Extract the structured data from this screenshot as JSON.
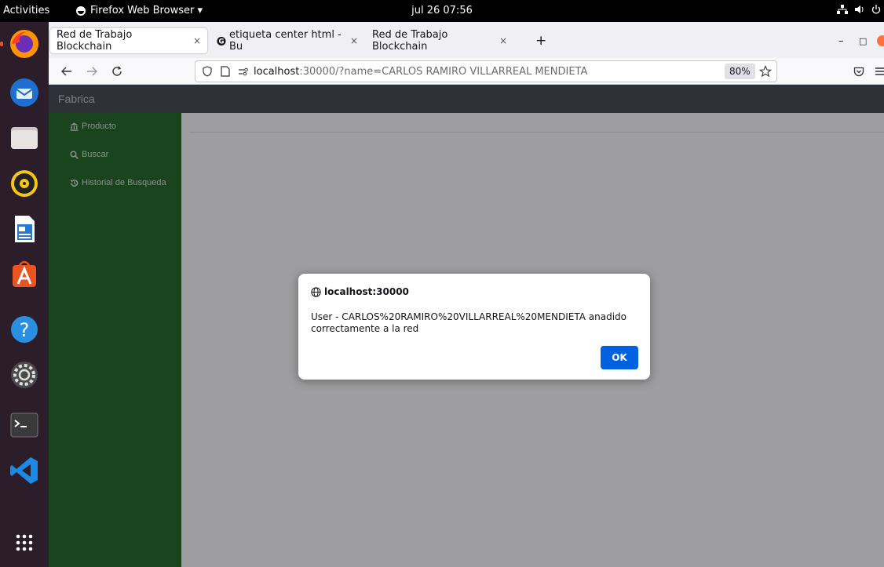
{
  "topbar": {
    "activities": "Activities",
    "app_menu": "Firefox Web Browser ▾",
    "clock": "jul 26  07:56"
  },
  "dock": {
    "items": [
      "firefox-icon",
      "thunderbird-icon",
      "files-icon",
      "rhythmbox-icon",
      "libreoffice-writer-icon",
      "software-center-icon",
      "help-icon",
      "settings-icon",
      "terminal-icon",
      "vscode-icon",
      "show-apps-icon"
    ]
  },
  "browser": {
    "tabs": [
      {
        "label": "Red de Trabajo Blockchain",
        "close": "×"
      },
      {
        "label": "etiqueta center html - Bu",
        "close": "×"
      },
      {
        "label": "Red de Trabajo Blockchain",
        "close": "×"
      }
    ],
    "new_tab": "+",
    "url_host": "localhost",
    "url_rest": ":30000/?name=CARLOS RAMIRO VILLARREAL MENDIETA",
    "zoom": "80%",
    "window_minimize": "–",
    "window_restore": "□"
  },
  "app": {
    "brand": "Fabrica",
    "sidebar": [
      {
        "icon": "bank-icon",
        "label": "Producto"
      },
      {
        "icon": "search-icon",
        "label": "Buscar"
      },
      {
        "icon": "history-icon",
        "label": "Historial de Busqueda"
      }
    ]
  },
  "dialog": {
    "title": "localhost:30000",
    "message": "User - CARLOS%20RAMIRO%20VILLARREAL%20MENDIETA anadido correctamente a la red",
    "ok": "OK"
  },
  "colors": {
    "sidebar": "#0f5c12",
    "header": "#343a40",
    "ok_button": "#0061e0",
    "dock": "#2b1e2a"
  }
}
